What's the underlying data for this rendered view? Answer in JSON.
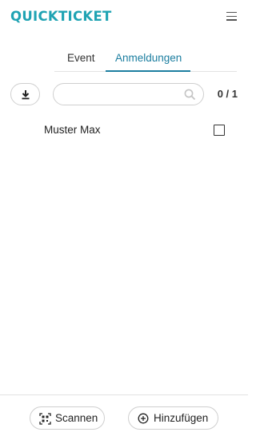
{
  "header": {
    "logo": "QUICKTICKET",
    "menu_icon": "hamburger-menu-icon"
  },
  "tabs": [
    {
      "label": "Event",
      "active": false
    },
    {
      "label": "Anmeldungen",
      "active": true
    }
  ],
  "toolbar": {
    "download_icon": "download-icon",
    "search": {
      "value": "",
      "placeholder": "",
      "icon": "search-icon"
    },
    "count": "0 / 1"
  },
  "registrations": [
    {
      "name": "Muster Max",
      "checked": false
    }
  ],
  "footer": {
    "scan_label": "Scannen",
    "scan_icon": "qr-scan-icon",
    "add_label": "Hinzufügen",
    "add_icon": "plus-circle-icon"
  },
  "colors": {
    "brand": "#1fa3b3",
    "accent": "#1c7ea0",
    "border": "#cfcfcf"
  }
}
